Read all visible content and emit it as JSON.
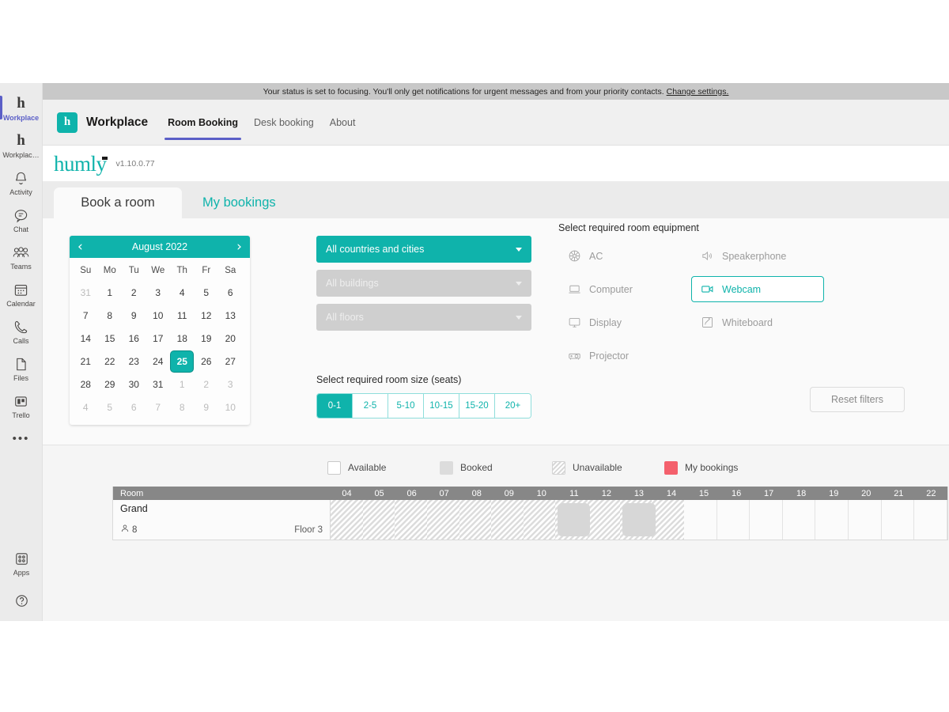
{
  "rail": {
    "items": [
      {
        "label": "Workplace",
        "icon": "humly-h-icon",
        "active": true
      },
      {
        "label": "Workplac…",
        "icon": "humly-h-icon",
        "active": false
      },
      {
        "label": "Activity",
        "icon": "bell-icon",
        "active": false
      },
      {
        "label": "Chat",
        "icon": "chat-bubble-icon",
        "active": false
      },
      {
        "label": "Teams",
        "icon": "people-icon",
        "active": false
      },
      {
        "label": "Calendar",
        "icon": "calendar-icon",
        "active": false
      },
      {
        "label": "Calls",
        "icon": "phone-icon",
        "active": false
      },
      {
        "label": "Files",
        "icon": "file-icon",
        "active": false
      },
      {
        "label": "Trello",
        "icon": "trello-icon",
        "active": false
      }
    ],
    "more_label": "•••",
    "bottom": [
      {
        "label": "Apps",
        "icon": "apps-grid-icon"
      },
      {
        "label": "",
        "icon": "help-question-icon"
      }
    ]
  },
  "status_banner": {
    "text": "Your status is set to focusing. You'll only get notifications for urgent messages and from your priority contacts.",
    "link": "Change settings."
  },
  "header": {
    "logo_glyph": "h",
    "title": "Workplace",
    "tabs": [
      {
        "label": "Room Booking",
        "active": true
      },
      {
        "label": "Desk booking",
        "active": false
      },
      {
        "label": "About",
        "active": false
      }
    ],
    "accent": "#5b5fc7"
  },
  "brand": {
    "name": "humly",
    "version": "v1.10.0.77",
    "color": "#0fb3ab"
  },
  "page_tabs": [
    {
      "label": "Book a room",
      "active": true
    },
    {
      "label": "My bookings",
      "active": false
    }
  ],
  "calendar": {
    "title": "August 2022",
    "prev_icon": "chevron-left-icon",
    "next_icon": "chevron-right-icon",
    "dow": [
      "Su",
      "Mo",
      "Tu",
      "We",
      "Th",
      "Fr",
      "Sa"
    ],
    "selected_day": 25,
    "weeks": [
      [
        {
          "d": "31",
          "muted": true
        },
        {
          "d": "1"
        },
        {
          "d": "2"
        },
        {
          "d": "3"
        },
        {
          "d": "4"
        },
        {
          "d": "5"
        },
        {
          "d": "6"
        }
      ],
      [
        {
          "d": "7"
        },
        {
          "d": "8"
        },
        {
          "d": "9"
        },
        {
          "d": "10"
        },
        {
          "d": "11"
        },
        {
          "d": "12"
        },
        {
          "d": "13"
        }
      ],
      [
        {
          "d": "14"
        },
        {
          "d": "15"
        },
        {
          "d": "16"
        },
        {
          "d": "17"
        },
        {
          "d": "18"
        },
        {
          "d": "19"
        },
        {
          "d": "20"
        }
      ],
      [
        {
          "d": "21"
        },
        {
          "d": "22"
        },
        {
          "d": "23"
        },
        {
          "d": "24"
        },
        {
          "d": "25",
          "sel": true
        },
        {
          "d": "26"
        },
        {
          "d": "27"
        }
      ],
      [
        {
          "d": "28"
        },
        {
          "d": "29"
        },
        {
          "d": "30"
        },
        {
          "d": "31"
        },
        {
          "d": "1",
          "muted": true
        },
        {
          "d": "2",
          "muted": true
        },
        {
          "d": "3",
          "muted": true
        }
      ],
      [
        {
          "d": "4",
          "muted": true
        },
        {
          "d": "5",
          "muted": true
        },
        {
          "d": "6",
          "muted": true
        },
        {
          "d": "7",
          "muted": true
        },
        {
          "d": "8",
          "muted": true
        },
        {
          "d": "9",
          "muted": true
        },
        {
          "d": "10",
          "muted": true
        }
      ]
    ]
  },
  "dropdowns": [
    {
      "label": "All countries and cities",
      "state": "primary"
    },
    {
      "label": "All buildings",
      "state": "disabled"
    },
    {
      "label": "All floors",
      "state": "disabled"
    }
  ],
  "equipment": {
    "title": "Select required room equipment",
    "items": [
      {
        "label": "AC",
        "icon": "ac-fan-icon",
        "selected": false
      },
      {
        "label": "Speakerphone",
        "icon": "speaker-icon",
        "selected": false
      },
      {
        "label": "Computer",
        "icon": "laptop-icon",
        "selected": false
      },
      {
        "label": "Webcam",
        "icon": "webcam-icon",
        "selected": true
      },
      {
        "label": "Display",
        "icon": "monitor-icon",
        "selected": false
      },
      {
        "label": "Whiteboard",
        "icon": "whiteboard-icon",
        "selected": false
      },
      {
        "label": "Projector",
        "icon": "projector-icon",
        "selected": false
      }
    ]
  },
  "room_size": {
    "title": "Select required room size (seats)",
    "options": [
      {
        "label": "0-1",
        "active": true
      },
      {
        "label": "2-5",
        "active": false
      },
      {
        "label": "5-10",
        "active": false
      },
      {
        "label": "10-15",
        "active": false
      },
      {
        "label": "15-20",
        "active": false
      },
      {
        "label": "20+",
        "active": false
      }
    ]
  },
  "reset_filters_label": "Reset filters",
  "legend": [
    {
      "label": "Available",
      "swatch": "sw-available"
    },
    {
      "label": "Booked",
      "swatch": "sw-booked"
    },
    {
      "label": "Unavailable",
      "swatch": "sw-unavailable"
    },
    {
      "label": "My bookings",
      "swatch": "sw-mybookings"
    }
  ],
  "schedule": {
    "room_col_header": "Room",
    "hours": [
      "04",
      "05",
      "06",
      "07",
      "08",
      "09",
      "10",
      "11",
      "12",
      "13",
      "14",
      "15",
      "16",
      "17",
      "18",
      "19",
      "20",
      "21",
      "22"
    ],
    "room": {
      "name": "Grand",
      "capacity": "8",
      "capacity_icon": "person-icon",
      "floor": "Floor 3"
    },
    "slot_states": [
      "unavail",
      "unavail",
      "unavail",
      "unavail",
      "unavail",
      "unavail",
      "unavail",
      "unavail",
      "unavail",
      "unavail",
      "unavail",
      "available",
      "available",
      "available",
      "available",
      "available",
      "available",
      "available",
      "available"
    ],
    "bookings": [
      {
        "start_hour_index": 7,
        "span": 1,
        "label": ""
      },
      {
        "start_hour_index": 9,
        "span": 1,
        "label": ""
      }
    ]
  }
}
